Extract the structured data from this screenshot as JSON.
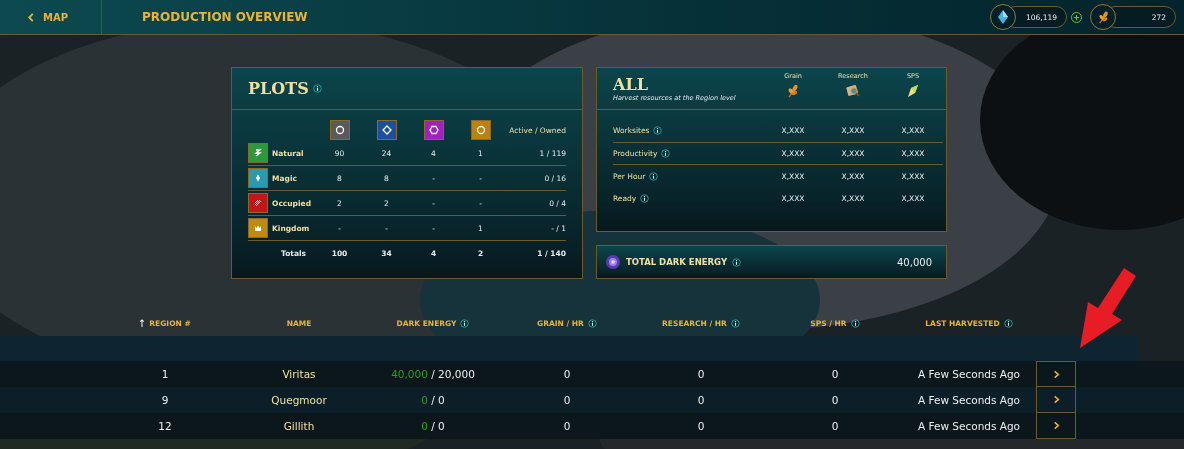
{
  "header": {
    "back_label": "MAP",
    "title": "PRODUCTION OVERVIEW",
    "currencies": [
      {
        "kind": "crystal",
        "value": "106,119",
        "add": true
      },
      {
        "kind": "grain",
        "value": "272",
        "add": false
      }
    ]
  },
  "plots": {
    "title": "PLOTS",
    "owned_header": "Active / Owned",
    "columns": [
      {
        "kind": "circle",
        "color": "#5a5a5a"
      },
      {
        "kind": "diamond",
        "color": "#1e4f9c"
      },
      {
        "kind": "hexagon",
        "color": "#a020c0"
      },
      {
        "kind": "circle",
        "color": "#c08010"
      }
    ],
    "rows": [
      {
        "kind": "natural",
        "color": "#2a9a3a",
        "label": "Natural",
        "values": [
          "90",
          "24",
          "4",
          "1"
        ],
        "active_owned": "1 / 119"
      },
      {
        "kind": "magic",
        "color": "#2a9ab0",
        "label": "Magic",
        "values": [
          "8",
          "8",
          "-",
          "-"
        ],
        "active_owned": "0 / 16"
      },
      {
        "kind": "occupied",
        "color": "#c01818",
        "label": "Occupied",
        "values": [
          "2",
          "2",
          "-",
          "-"
        ],
        "active_owned": "0 / 4"
      },
      {
        "kind": "kingdom",
        "color": "#c08a10",
        "label": "Kingdom",
        "values": [
          "-",
          "-",
          "-",
          "1"
        ],
        "active_owned": "- / 1"
      }
    ],
    "totals": {
      "label": "Totals",
      "values": [
        "100",
        "34",
        "4",
        "2"
      ],
      "active_owned": "1 / 140"
    }
  },
  "all": {
    "title": "ALL",
    "subtitle": "Harvest resources at the Region level",
    "resources": [
      {
        "kind": "grain",
        "label": "Grain"
      },
      {
        "kind": "research",
        "label": "Research"
      },
      {
        "kind": "sps",
        "label": "SPS"
      }
    ],
    "rows": [
      {
        "label": "Worksites",
        "values": [
          "X,XXX",
          "X,XXX",
          "X,XXX"
        ],
        "divider": true
      },
      {
        "label": "Productivity",
        "values": [
          "X,XXX",
          "X,XXX",
          "X,XXX"
        ],
        "divider": true
      },
      {
        "label": "Per Hour",
        "values": [
          "X,XXX",
          "X,XXX",
          "X,XXX"
        ],
        "divider": false
      },
      {
        "label": "Ready",
        "values": [
          "X,XXX",
          "X,XXX",
          "X,XXX"
        ],
        "divider": false
      }
    ]
  },
  "dark_energy": {
    "label": "TOTAL DARK ENERGY",
    "value": "40,000"
  },
  "table": {
    "columns": [
      {
        "label": "REGION #",
        "sorted": true,
        "info": false
      },
      {
        "label": "NAME",
        "sorted": false,
        "info": false
      },
      {
        "label": "DARK ENERGY",
        "sorted": false,
        "info": true
      },
      {
        "label": "GRAIN / HR",
        "sorted": false,
        "info": true
      },
      {
        "label": "RESEARCH / HR",
        "sorted": false,
        "info": true
      },
      {
        "label": "SPS / HR",
        "sorted": false,
        "info": true
      },
      {
        "label": "LAST HARVESTED",
        "sorted": false,
        "info": true
      }
    ],
    "rows": [
      {
        "region": "1",
        "name": "Viritas",
        "dark_current": "40,000",
        "dark_rest": "/ 20,000",
        "grain": "0",
        "research": "0",
        "sps": "0",
        "last": "A Few Seconds Ago"
      },
      {
        "region": "9",
        "name": "Quegmoor",
        "dark_current": "0",
        "dark_rest": "/ 0",
        "grain": "0",
        "research": "0",
        "sps": "0",
        "last": "A Few Seconds Ago"
      },
      {
        "region": "12",
        "name": "Gillith",
        "dark_current": "0",
        "dark_rest": "/ 0",
        "grain": "0",
        "research": "0",
        "sps": "0",
        "last": "A Few Seconds Ago"
      }
    ]
  },
  "annotation_arrow": true
}
